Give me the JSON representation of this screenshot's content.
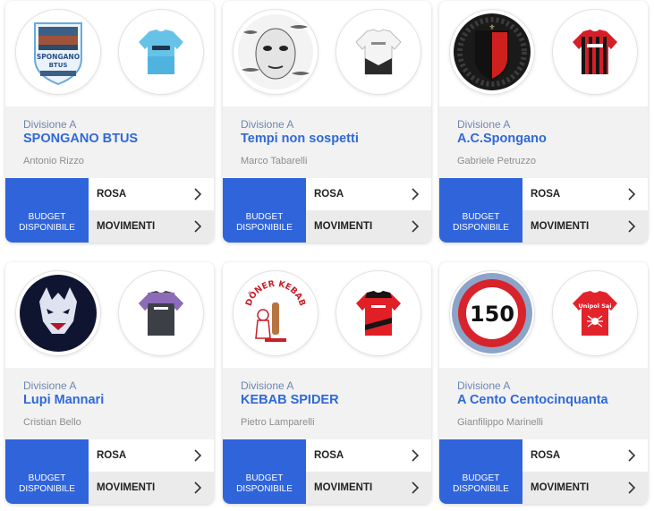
{
  "labels": {
    "budget_line1": "BUDGET",
    "budget_line2": "DISPONIBILE",
    "rosa": "ROSA",
    "movimenti": "MOVIMENTI"
  },
  "teams": [
    {
      "division": "Divisione A",
      "name": "SPONGANO BTUS",
      "owner": "Antonio Rizzo",
      "logo": "spongano-btus-crest",
      "shirt": "sky-blue-shirt"
    },
    {
      "division": "Divisione A",
      "name": "Tempi non sospetti",
      "owner": "Marco Tabarelli",
      "logo": "face-and-fish-illustration",
      "shirt": "white-shirt"
    },
    {
      "division": "Divisione A",
      "name": "A.C.Spongano",
      "owner": "Gabriele Petruzzo",
      "logo": "ac-spongano-shield",
      "shirt": "red-black-striped-shirt"
    },
    {
      "division": "Divisione A",
      "name": "Lupi Mannari",
      "owner": "Cristian Bello",
      "logo": "werewolf-illustration",
      "shirt": "purple-grey-shirt"
    },
    {
      "division": "Divisione A",
      "name": "KEBAB SPIDER",
      "owner": "Pietro Lamparelli",
      "logo": "doner-kebab-logo",
      "shirt": "red-black-shirt"
    },
    {
      "division": "Divisione A",
      "name": "A Cento Centocinquanta",
      "owner": "Gianfilippo Marinelli",
      "logo": "speed-limit-150-sign",
      "shirt": "red-spider-shirt"
    }
  ],
  "logo_text": {
    "spongano": "SPONGANO",
    "btus": "BTUS",
    "doner": "DÖNER KEBAB",
    "speed": "150",
    "sponsor": "Unipol Sai"
  },
  "colors": {
    "accent_blue": "#2f64db",
    "team_name": "#2f69d8",
    "division": "#6f86ad",
    "info_bg": "#f2f2f3"
  }
}
